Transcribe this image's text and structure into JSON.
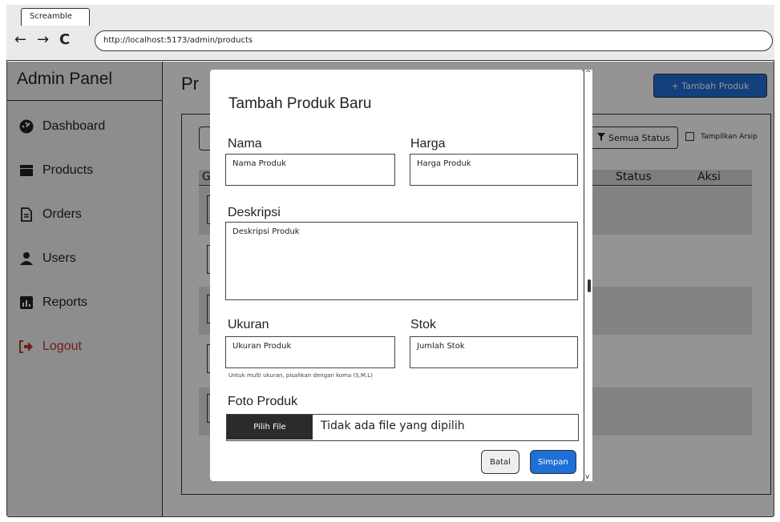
{
  "browser": {
    "tab_title": "Screamble",
    "url": "http://localhost:5173/admin/products",
    "back_glyph": "←",
    "forward_glyph": "→",
    "reload_glyph": "C"
  },
  "sidebar": {
    "title": "Admin Panel",
    "items": [
      {
        "label": "Dashboard",
        "icon": "dashboard-icon"
      },
      {
        "label": "Products",
        "icon": "box-icon"
      },
      {
        "label": "Orders",
        "icon": "document-icon"
      },
      {
        "label": "Users",
        "icon": "user-icon"
      },
      {
        "label": "Reports",
        "icon": "chart-icon"
      },
      {
        "label": "Logout",
        "icon": "logout-icon"
      }
    ]
  },
  "page": {
    "title_visible": "Pr",
    "add_button": "+ Tambah Produk",
    "status_filter": "Semua Status",
    "archive_toggle": "Tampilkan Arsip",
    "table_headers": {
      "first": "G",
      "status": "Status",
      "actions": "Aksi"
    }
  },
  "modal": {
    "title": "Tambah Produk Baru",
    "name_label": "Nama",
    "name_placeholder": "Nama Produk",
    "price_label": "Harga",
    "price_placeholder": "Harga Produk",
    "desc_label": "Deskripsi",
    "desc_placeholder": "Deskripsi Produk",
    "size_label": "Ukuran",
    "size_placeholder": "Ukuran Produk",
    "size_hint": "Untuk multi ukuran, pisahkan dengan koma (S,M,L)",
    "stock_label": "Stok",
    "stock_placeholder": "Jumlah Stok",
    "photo_label": "Foto Produk",
    "file_button": "Pilih File",
    "file_status": "Tidak ada file yang dipilih",
    "cancel_button": "Batal",
    "save_button": "Simpan"
  },
  "colors": {
    "primary": "#1f6fd6",
    "logout": "#c0392b",
    "overlay": "rgba(0,0,0,0.42)"
  }
}
